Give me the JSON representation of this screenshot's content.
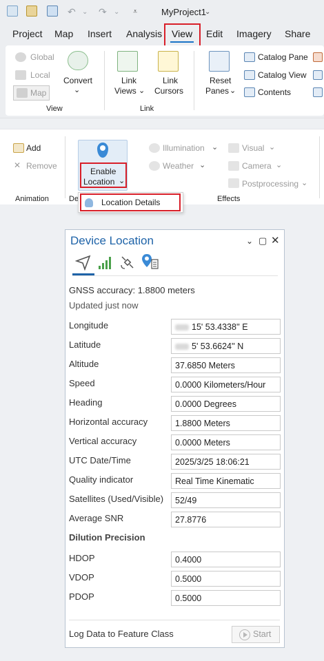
{
  "project_title": "MyProject1",
  "menu": {
    "items": [
      "Project",
      "Map",
      "Insert",
      "Analysis",
      "View",
      "Edit",
      "Imagery",
      "Share"
    ],
    "active": "View"
  },
  "ribbon_view": {
    "global_label": "Global",
    "local_label": "Local",
    "map_label": "Map",
    "convert_label": "Convert",
    "view_group": "View",
    "link_views_label_1": "Link",
    "link_views_label_2": "Views",
    "link_cursors_label_1": "Link",
    "link_cursors_label_2": "Cursors",
    "link_group": "Link",
    "reset_panes_label_1": "Reset",
    "reset_panes_label_2": "Panes",
    "catalog_pane_label": "Catalog Pane",
    "catalog_view_label": "Catalog View",
    "contents_label": "Contents"
  },
  "ribbon_device": {
    "add_label": "Add",
    "remove_label": "Remove",
    "animation_group": "Animation",
    "device_group_partial": "De",
    "enable_location_label_1": "Enable",
    "enable_location_label_2": "Location",
    "illumination_label": "Illumination",
    "weather_label": "Weather",
    "visual_label": "Visual",
    "camera_label": "Camera",
    "postprocessing_label": "Postprocessing",
    "effects_group": "Effects",
    "dropdown_item": "Location Details"
  },
  "panel": {
    "title": "Device Location",
    "gnss_accuracy": "GNSS accuracy: 1.8800 meters",
    "updated": "Updated just now",
    "fields": [
      {
        "label": "Longitude",
        "value": "15' 53.4338'' E"
      },
      {
        "label": "Latitude",
        "value": "5' 53.6624'' N"
      },
      {
        "label": "Altitude",
        "value": "37.6850 Meters"
      },
      {
        "label": "Speed",
        "value": "0.0000 Kilometers/Hour"
      },
      {
        "label": "Heading",
        "value": "0.0000 Degrees"
      },
      {
        "label": "Horizontal accuracy",
        "value": "1.8800 Meters"
      },
      {
        "label": "Vertical accuracy",
        "value": "0.0000 Meters"
      },
      {
        "label": "UTC Date/Time",
        "value": "2025/3/25 18:06:21"
      },
      {
        "label": "Quality indicator",
        "value": "Real Time Kinematic"
      },
      {
        "label": "Satellites (Used/Visible)",
        "value": "52/49"
      },
      {
        "label": "Average SNR",
        "value": "27.8776"
      }
    ],
    "dilution_title": "Dilution Precision",
    "dilution": [
      {
        "label": "HDOP",
        "value": "0.4000"
      },
      {
        "label": "VDOP",
        "value": "0.5000"
      },
      {
        "label": "PDOP",
        "value": "0.5000"
      }
    ],
    "log_label": "Log Data to Feature Class",
    "start_label": "Start"
  },
  "colors": {
    "accent": "#1e63a8",
    "highlight_red": "#d81e28",
    "pin_blue": "#3a8ad6",
    "signal_green": "#4aa04a"
  }
}
